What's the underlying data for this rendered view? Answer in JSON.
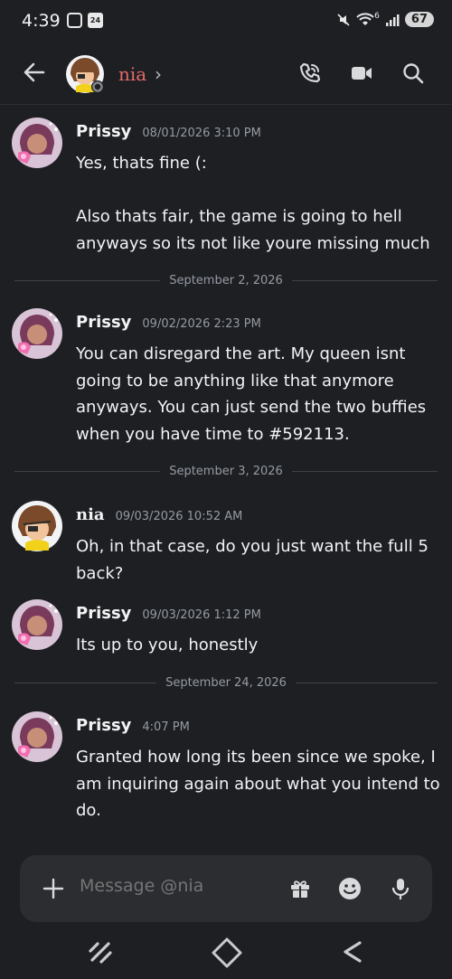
{
  "status_bar": {
    "time": "4:39",
    "badge": "24",
    "wifi_label": "6",
    "battery": "67"
  },
  "header": {
    "name": "nia",
    "chevron": "›",
    "icons": [
      "back-arrow-icon",
      "phone-call-icon",
      "video-camera-icon",
      "search-icon"
    ]
  },
  "messages": [
    {
      "author": "Prissy",
      "timestamp": "08/01/2026 3:10 PM",
      "text": "Yes, thats fine (:\n\nAlso thats fair, the game is going to hell anyways so its not like youre missing much"
    },
    {
      "author": "Prissy",
      "timestamp": "09/02/2026 2:23 PM",
      "text": "You can disregard the art. My queen isnt going to be anything like that anymore anyways. You can just send the two buffies when you have time to #592113."
    },
    {
      "author": "nia",
      "timestamp": "09/03/2026 10:52 AM",
      "text": "Oh, in that case, do you just want the full 5 back?"
    },
    {
      "author": "Prissy",
      "timestamp": "09/03/2026 1:12 PM",
      "text": "Its up to you, honestly"
    },
    {
      "author": "Prissy",
      "timestamp": "4:07 PM",
      "text": "Granted how long its been since we spoke, I am inquiring again about what you intend to do."
    }
  ],
  "dividers": [
    "September 2, 2026",
    "September 3, 2026",
    "September 24, 2026"
  ],
  "composer": {
    "placeholder": "Message @nia",
    "icons": [
      "plus-icon",
      "gift-icon",
      "emoji-icon",
      "microphone-icon"
    ]
  },
  "colors": {
    "background": "#1e1f22",
    "composer": "#2b2d31",
    "nia_name": "#e46a6a",
    "timestamp": "#949ba4"
  }
}
